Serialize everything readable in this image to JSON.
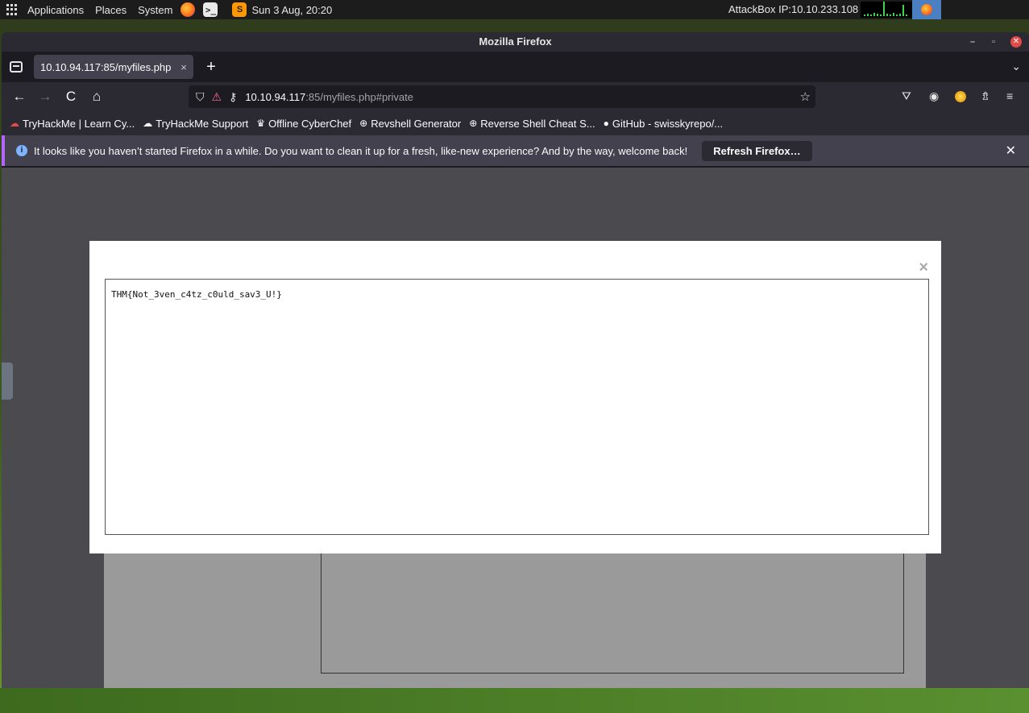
{
  "panel": {
    "applications": "Applications",
    "places": "Places",
    "system": "System",
    "clock": "Sun 3 Aug, 20:20",
    "attackbox_ip": "AttackBox IP:10.10.233.108",
    "terminal_glyph": ">_",
    "sublime_glyph": "S"
  },
  "window": {
    "title": "Mozilla Firefox",
    "min": "–",
    "max": "▫",
    "close": "✕"
  },
  "tab": {
    "title": "10.10.94.117:85/myfiles.php",
    "close": "×",
    "new_tab": "+",
    "overflow": "⌄"
  },
  "nav": {
    "back": "←",
    "forward": "→",
    "reload": "C",
    "home": "⌂",
    "url_host": "10.10.94.117",
    "url_rest": ":85/myfiles.php#private",
    "shield": "⛉",
    "insecure": "⚠",
    "key": "⚷",
    "star": "☆",
    "pocket": "⛛",
    "account": "◉",
    "extensions": "⇯",
    "menu": "≡"
  },
  "bookmarks": [
    {
      "label": "TryHackMe | Learn Cy...",
      "icon": "☁"
    },
    {
      "label": "TryHackMe Support",
      "icon": "☁"
    },
    {
      "label": "Offline CyberChef",
      "icon": "♛"
    },
    {
      "label": "Revshell Generator",
      "icon": "⊕"
    },
    {
      "label": "Reverse Shell Cheat S...",
      "icon": "⊕"
    },
    {
      "label": "GitHub - swisskyrepo/...",
      "icon": "●"
    }
  ],
  "notification": {
    "info": "i",
    "message": "It looks like you haven’t started Firefox in a while. Do you want to clean it up for a fresh, like-new experience? And by the way, welcome back!",
    "button": "Refresh Firefox…",
    "close": "✕"
  },
  "modal": {
    "close": "×",
    "content": "THM{Not_3ven_c4tz_c0uld_sav3_U!}"
  },
  "colors": {
    "accent": "#b464ff",
    "toolbar": "#2b2a33",
    "insecure": "#ff6b8a"
  }
}
